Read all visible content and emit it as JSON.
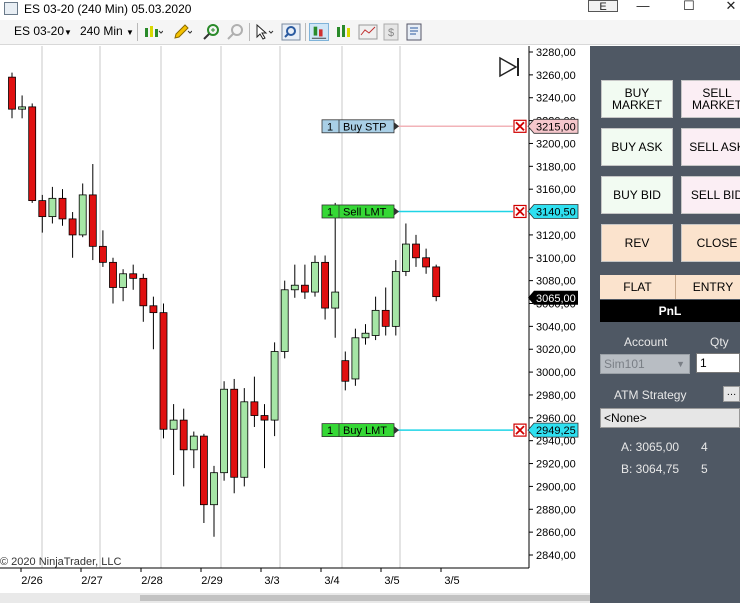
{
  "window": {
    "title": "ES 03-20 (240 Min)  05.03.2020",
    "e_button": "E",
    "minimize": "—",
    "maximize": "☐",
    "close": "✕"
  },
  "toolbar": {
    "instrument": "ES 03-20",
    "interval": "240 Min"
  },
  "chart": {
    "copyright": "© 2020 NinjaTrader, LLC",
    "price_labels": [
      "3280,00",
      "3260,00",
      "3240,00",
      "3220,00",
      "3200,00",
      "3180,00",
      "3160,00",
      "3140,00",
      "3120,00",
      "3100,00",
      "3080,00",
      "3060,00",
      "3040,00",
      "3020,00",
      "3000,00",
      "2980,00",
      "2960,00",
      "2940,00",
      "2920,00",
      "2900,00",
      "2880,00",
      "2860,00",
      "2840,00"
    ],
    "date_labels": [
      "2/26",
      "2/27",
      "2/28",
      "2/29",
      "3/3",
      "3/4",
      "3/5",
      "3/5"
    ],
    "current_price": "3065,00",
    "orders": [
      {
        "qty": "1",
        "label": "Buy STP",
        "price": "3215,00",
        "color": "#a9cfe6",
        "line": "#f2b3b8",
        "tag": "#f6c7cc"
      },
      {
        "qty": "1",
        "label": "Sell LMT",
        "price": "3140,50",
        "color": "#35d835",
        "line": "#1fd4e6",
        "tag": "#2fe0f0"
      },
      {
        "qty": "1",
        "label": "Buy LMT",
        "price": "2949,25",
        "color": "#35d835",
        "line": "#1fd4e6",
        "tag": "#2fe0f0"
      }
    ],
    "chart_data": {
      "type": "candlestick",
      "xlabels": [
        "2/26",
        "2/27",
        "2/28",
        "2/29",
        "3/3",
        "3/4",
        "3/5",
        "3/5"
      ],
      "ylim": [
        2830,
        3290
      ],
      "candles": [
        {
          "o": 3258,
          "h": 3262,
          "l": 3222,
          "c": 3230
        },
        {
          "o": 3230,
          "h": 3242,
          "l": 3222,
          "c": 3232
        },
        {
          "o": 3232,
          "h": 3235,
          "l": 3148,
          "c": 3150
        },
        {
          "o": 3150,
          "h": 3155,
          "l": 3122,
          "c": 3136
        },
        {
          "o": 3136,
          "h": 3162,
          "l": 3130,
          "c": 3152
        },
        {
          "o": 3152,
          "h": 3160,
          "l": 3128,
          "c": 3134
        },
        {
          "o": 3134,
          "h": 3140,
          "l": 3100,
          "c": 3120
        },
        {
          "o": 3120,
          "h": 3165,
          "l": 3118,
          "c": 3155
        },
        {
          "o": 3155,
          "h": 3182,
          "l": 3098,
          "c": 3110
        },
        {
          "o": 3110,
          "h": 3124,
          "l": 3092,
          "c": 3096
        },
        {
          "o": 3096,
          "h": 3100,
          "l": 3060,
          "c": 3074
        },
        {
          "o": 3074,
          "h": 3090,
          "l": 3062,
          "c": 3086
        },
        {
          "o": 3086,
          "h": 3094,
          "l": 3072,
          "c": 3082
        },
        {
          "o": 3082,
          "h": 3086,
          "l": 3044,
          "c": 3058
        },
        {
          "o": 3058,
          "h": 3066,
          "l": 3020,
          "c": 3052
        },
        {
          "o": 3052,
          "h": 3060,
          "l": 2942,
          "c": 2950
        },
        {
          "o": 2950,
          "h": 2972,
          "l": 2910,
          "c": 2958
        },
        {
          "o": 2958,
          "h": 2968,
          "l": 2900,
          "c": 2932
        },
        {
          "o": 2932,
          "h": 2948,
          "l": 2916,
          "c": 2944
        },
        {
          "o": 2944,
          "h": 2946,
          "l": 2868,
          "c": 2884
        },
        {
          "o": 2884,
          "h": 2918,
          "l": 2856,
          "c": 2912
        },
        {
          "o": 2912,
          "h": 2992,
          "l": 2905,
          "c": 2985
        },
        {
          "o": 2985,
          "h": 2994,
          "l": 2894,
          "c": 2908
        },
        {
          "o": 2908,
          "h": 2986,
          "l": 2900,
          "c": 2974
        },
        {
          "o": 2974,
          "h": 2996,
          "l": 2952,
          "c": 2962
        },
        {
          "o": 2962,
          "h": 2972,
          "l": 2916,
          "c": 2958
        },
        {
          "o": 2958,
          "h": 3026,
          "l": 2944,
          "c": 3018
        },
        {
          "o": 3018,
          "h": 3080,
          "l": 3012,
          "c": 3072
        },
        {
          "o": 3072,
          "h": 3094,
          "l": 3065,
          "c": 3076
        },
        {
          "o": 3076,
          "h": 3094,
          "l": 3064,
          "c": 3070
        },
        {
          "o": 3070,
          "h": 3102,
          "l": 3066,
          "c": 3096
        },
        {
          "o": 3096,
          "h": 3102,
          "l": 3046,
          "c": 3056
        },
        {
          "o": 3056,
          "h": 3148,
          "l": 3030,
          "c": 3070
        },
        {
          "o": 3010,
          "h": 3018,
          "l": 2984,
          "c": 2992
        },
        {
          "o": 2994,
          "h": 3038,
          "l": 2988,
          "c": 3030
        },
        {
          "o": 3030,
          "h": 3042,
          "l": 3024,
          "c": 3034
        },
        {
          "o": 3032,
          "h": 3066,
          "l": 3028,
          "c": 3054
        },
        {
          "o": 3054,
          "h": 3074,
          "l": 3032,
          "c": 3040
        },
        {
          "o": 3040,
          "h": 3098,
          "l": 3032,
          "c": 3088
        },
        {
          "o": 3088,
          "h": 3130,
          "l": 3084,
          "c": 3112
        },
        {
          "o": 3112,
          "h": 3120,
          "l": 3092,
          "c": 3100
        },
        {
          "o": 3100,
          "h": 3108,
          "l": 3086,
          "c": 3092
        },
        {
          "o": 3092,
          "h": 3094,
          "l": 3062,
          "c": 3066
        }
      ]
    }
  },
  "panel": {
    "buttons": {
      "buy_market": "BUY\nMARKET",
      "sell_market": "SELL\nMARKET",
      "buy_ask": "BUY ASK",
      "sell_ask": "SELL ASK",
      "buy_bid": "BUY BID",
      "sell_bid": "SELL BID",
      "rev": "REV",
      "close": "CLOSE"
    },
    "tabs": {
      "flat": "FLAT",
      "entry": "ENTRY"
    },
    "pnl": "PnL",
    "account_label": "Account",
    "qty_label": "Qty",
    "account_value": "Sim101",
    "qty_value": "1",
    "atm_label": "ATM Strategy",
    "atm_value": "<None>",
    "ask_label": "A: 3065,00",
    "ask_qty": "4",
    "bid_label": "B: 3064,75",
    "bid_qty": "5"
  }
}
